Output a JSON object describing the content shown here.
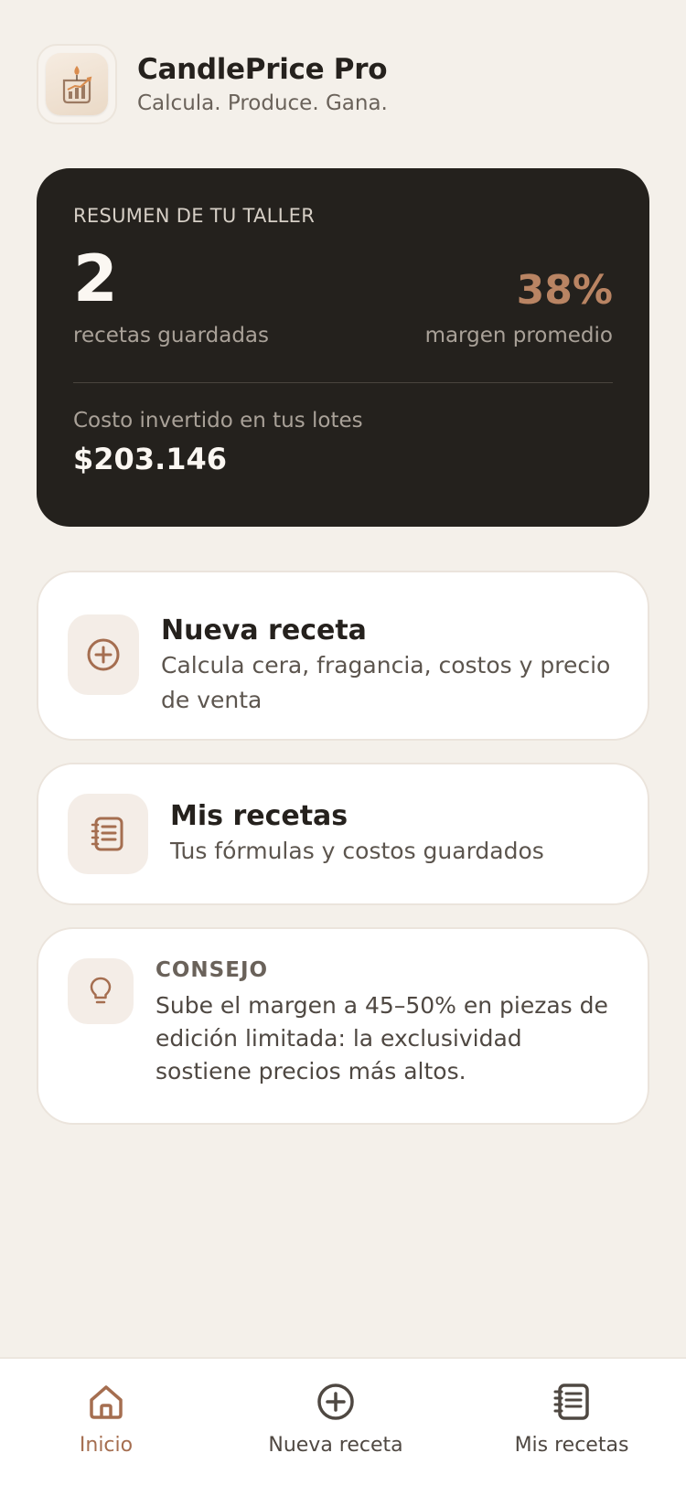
{
  "app": {
    "title": "CandlePrice Pro",
    "subtitle": "Calcula. Produce. Gana."
  },
  "summary": {
    "label": "RESUMEN DE TU TALLER",
    "recipes_count": "2",
    "recipes_label": "recetas guardadas",
    "margin_value": "38%",
    "margin_label": "margen promedio",
    "cost_label": "Costo invertido en tus lotes",
    "cost_value": "$203.146"
  },
  "cards": {
    "new_recipe": {
      "title": "Nueva receta",
      "description": "Calcula cera, fragancia, costos y precio de venta",
      "icon": "plus-circle-icon"
    },
    "my_recipes": {
      "title": "Mis recetas",
      "description": "Tus fórmulas y costos guardados",
      "icon": "notebook-icon"
    },
    "tip": {
      "label": "CONSEJO",
      "text": "Sube el margen a 45–50% en piezas de edición limitada: la exclusividad sostiene precios más altos.",
      "icon": "lightbulb-icon"
    }
  },
  "tabbar": {
    "items": [
      {
        "label": "Inicio",
        "icon": "home-icon",
        "active": true
      },
      {
        "label": "Nueva receta",
        "icon": "plus-circle-icon",
        "active": false
      },
      {
        "label": "Mis recetas",
        "icon": "notebook-icon",
        "active": false
      }
    ]
  },
  "colors": {
    "background": "#f4f0ea",
    "dark_card": "#24211d",
    "accent": "#a56e50",
    "accent_light": "#b98463",
    "icon_tile": "#f4ede7"
  }
}
